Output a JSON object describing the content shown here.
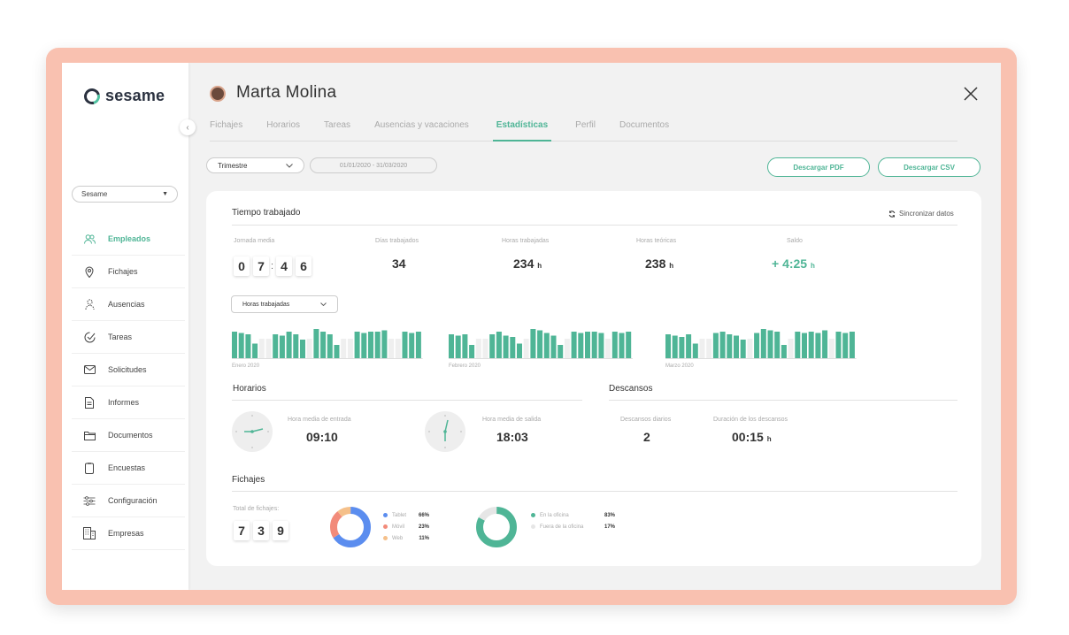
{
  "brand": {
    "name": "sesame"
  },
  "sidebar": {
    "company": "Sesame",
    "items": [
      {
        "label": "Empleados",
        "icon": "users-icon",
        "active": true
      },
      {
        "label": "Fichajes",
        "icon": "location-pin-icon"
      },
      {
        "label": "Ausencias",
        "icon": "person-dashed-icon"
      },
      {
        "label": "Tareas",
        "icon": "tasks-icon"
      },
      {
        "label": "Solicitudes",
        "icon": "envelope-icon"
      },
      {
        "label": "Informes",
        "icon": "document-icon"
      },
      {
        "label": "Documentos",
        "icon": "folder-icon"
      },
      {
        "label": "Encuestas",
        "icon": "clipboard-icon"
      },
      {
        "label": "Configuración",
        "icon": "sliders-icon"
      },
      {
        "label": "Empresas",
        "icon": "building-icon"
      }
    ]
  },
  "header": {
    "user_name": "Marta Molina"
  },
  "tabs": [
    "Fichajes",
    "Horarios",
    "Tareas",
    "Ausencias y vacaciones",
    "Estadísticas",
    "Perfil",
    "Documentos"
  ],
  "active_tab": "Estadísticas",
  "toolbar": {
    "period": "Trimestre",
    "date_range": "01/01/2020 - 31/03/2020",
    "download_pdf": "Descargar PDF",
    "download_csv": "Descargar CSV"
  },
  "tiempo": {
    "title": "Tiempo trabajado",
    "sync_label": "Sincronizar datos",
    "jornada_label": "Jornada media",
    "jornada_digits": [
      "0",
      "7",
      "4",
      "6"
    ],
    "dias_label": "Días trabajados",
    "dias_value": "34",
    "horas_label": "Horas trabajadas",
    "horas_value": "234",
    "horas_unit": "h",
    "teoricas_label": "Horas teóricas",
    "teoricas_value": "238",
    "teoricas_unit": "h",
    "saldo_label": "Saldo",
    "saldo_value": "+ 4:25",
    "saldo_unit": "h",
    "chart_select": "Horas trabajadas"
  },
  "chart_data": {
    "type": "bar",
    "series": [
      {
        "month": "Enero 2020",
        "values": [
          1.0,
          0.95,
          0.9,
          0.55,
          0,
          0,
          0.9,
          0.85,
          1.0,
          0.9,
          0.7,
          0,
          1.1,
          1.0,
          0.9,
          0.5,
          0,
          0,
          1.0,
          0.95,
          1.0,
          1.0,
          1.05,
          0,
          0,
          1.0,
          0.95,
          1.0
        ]
      },
      {
        "month": "Febrero 2020",
        "values": [
          0.9,
          0.85,
          0.9,
          0.5,
          0,
          0,
          0.9,
          1.0,
          0.85,
          0.8,
          0.55,
          0,
          1.1,
          1.05,
          0.95,
          0.85,
          0.5,
          0,
          1.0,
          0.95,
          1.0,
          1.0,
          0.95,
          0,
          1.0,
          0.95,
          1.0
        ]
      },
      {
        "month": "Marzo 2020",
        "values": [
          0.9,
          0.85,
          0.8,
          0.9,
          0.55,
          0,
          0,
          0.95,
          1.0,
          0.9,
          0.85,
          0.7,
          0,
          0.95,
          1.1,
          1.05,
          1.0,
          0.5,
          0,
          1.0,
          0.95,
          1.0,
          0.95,
          1.05,
          0,
          1.0,
          0.95,
          1.0
        ]
      }
    ]
  },
  "horarios": {
    "title": "Horarios",
    "entrada_label": "Hora media de entrada",
    "entrada_value": "09:10",
    "salida_label": "Hora media de salida",
    "salida_value": "18:03"
  },
  "descansos": {
    "title": "Descansos",
    "diarios_label": "Descansos diarios",
    "diarios_value": "2",
    "duracion_label": "Duración de los descansos",
    "duracion_value": "00:15",
    "duracion_unit": "h"
  },
  "fichajes": {
    "title": "Fichajes",
    "total_label": "Total de fichajes:",
    "total_digits": [
      "7",
      "3",
      "9"
    ],
    "devices": [
      {
        "label": "Tablet",
        "pct": "66%",
        "value": 66,
        "color": "#5b8def"
      },
      {
        "label": "Móvil",
        "pct": "23%",
        "value": 23,
        "color": "#f28b7a"
      },
      {
        "label": "Web",
        "pct": "11%",
        "value": 11,
        "color": "#f5c08a"
      }
    ],
    "location": [
      {
        "label": "En la oficina",
        "pct": "83%",
        "value": 83,
        "color": "#4fb596"
      },
      {
        "label": "Fuera de la oficina",
        "pct": "17%",
        "value": 17,
        "color": "#e6e6e6"
      }
    ]
  },
  "colors": {
    "accent": "#4fb596",
    "frame": "#f9c1b0"
  }
}
